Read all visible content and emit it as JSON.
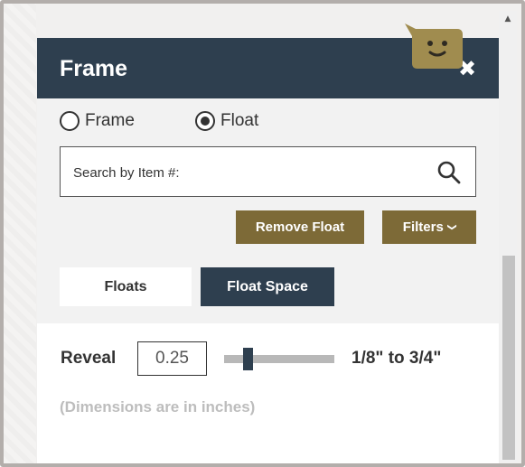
{
  "panel": {
    "title": "Frame",
    "close_glyph": "✖",
    "close_icon": "close-icon",
    "header_color": "#2e3f4f",
    "mascot_icon": "smiley-chat-icon",
    "mascot_color": "#a08c4f"
  },
  "mode": {
    "options": [
      {
        "label": "Frame",
        "selected": false
      },
      {
        "label": "Float",
        "selected": true
      }
    ]
  },
  "search": {
    "placeholder": "Search by Item #:",
    "value": "",
    "icon": "search-icon"
  },
  "actions": {
    "remove_label": "Remove Float",
    "filters_label": "Filters",
    "filters_chevron": "❯",
    "accent_color": "#7d6a37"
  },
  "tabs": [
    {
      "label": "Floats",
      "active": false
    },
    {
      "label": "Float Space",
      "active": true
    }
  ],
  "reveal": {
    "label": "Reveal",
    "value": "0.25",
    "range_text": "1/8\" to 3/4\"",
    "slider_level_fraction": 0.2,
    "note": "(Dimensions are in inches)"
  },
  "scrollbar": {
    "up_glyph": "▲"
  }
}
